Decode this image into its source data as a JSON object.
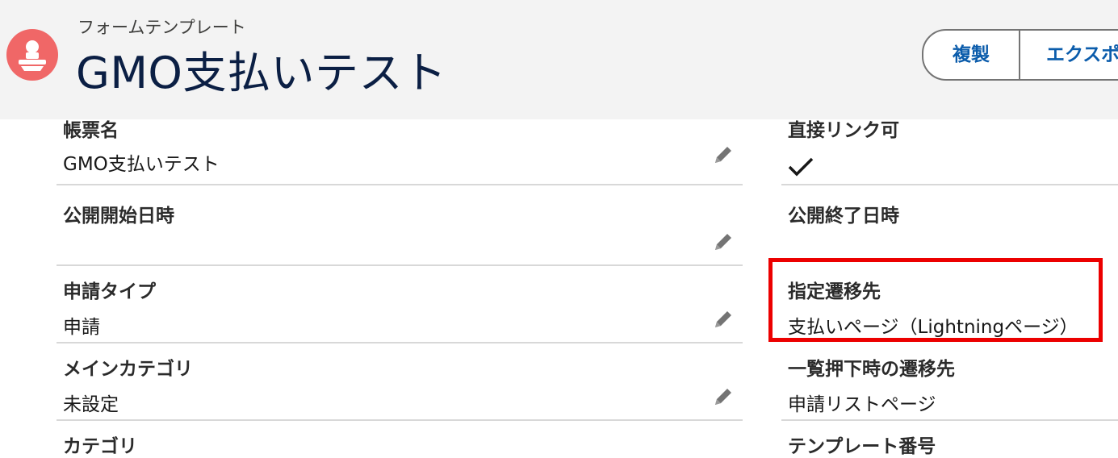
{
  "header": {
    "object_label": "フォームテンプレート",
    "record_title": "GMO支払いテスト",
    "icon": "form-template-icon",
    "icon_color": "#f06767",
    "buttons": {
      "clone": "複製",
      "export": "エクスポー"
    }
  },
  "fields": {
    "form_name": {
      "label": "帳票名",
      "value": "GMO支払いテスト"
    },
    "direct_link": {
      "label": "直接リンク可",
      "value_icon": "checkmark-icon"
    },
    "publish_start": {
      "label": "公開開始日時",
      "value": ""
    },
    "publish_end": {
      "label": "公開終了日時",
      "value": ""
    },
    "request_type": {
      "label": "申請タイプ",
      "value": "申請"
    },
    "redirect_target": {
      "label": "指定遷移先",
      "value": "支払いページ（Lightningページ）"
    },
    "main_category": {
      "label": "メインカテゴリ",
      "value": "未設定"
    },
    "list_redirect": {
      "label": "一覧押下時の遷移先",
      "value": "申請リストページ"
    },
    "category": {
      "label": "カテゴリ"
    },
    "template_number": {
      "label": "テンプレート番号"
    }
  },
  "colors": {
    "header_bg": "#f3f3f3",
    "title": "#0b1f44",
    "button_text": "#0b5cab",
    "highlight": "#ec0000"
  }
}
